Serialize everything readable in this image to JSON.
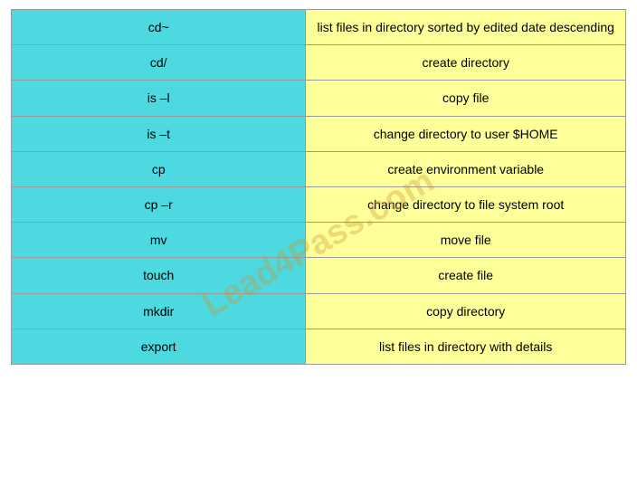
{
  "watermark": "Lead4Pass.com",
  "rows": [
    {
      "left": "cd~",
      "right": "list files in directory sorted by edited date descending"
    },
    {
      "left": "cd/",
      "right": "create directory"
    },
    {
      "left": "is –l",
      "right": "copy file"
    },
    {
      "left": "is –t",
      "right": "change directory to user $HOME"
    },
    {
      "left": "cp",
      "right": "create environment variable"
    },
    {
      "left": "cp –r",
      "right": "change directory to file system root"
    },
    {
      "left": "mv",
      "right": "move file"
    },
    {
      "left": "touch",
      "right": "create file"
    },
    {
      "left": "mkdir",
      "right": "copy directory"
    },
    {
      "left": "export",
      "right": "list files in directory with details"
    }
  ]
}
